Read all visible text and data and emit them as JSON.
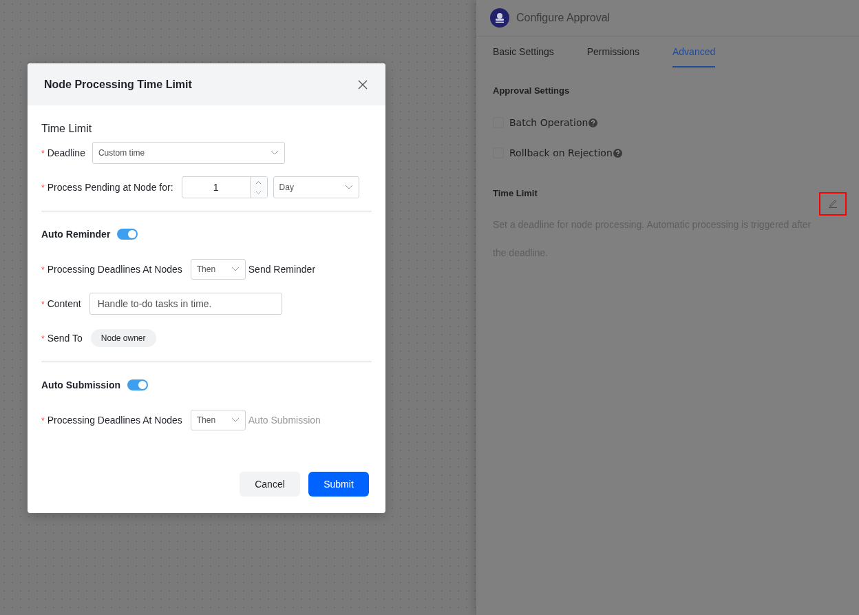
{
  "panel": {
    "title": "Configure Approval",
    "tabs": [
      {
        "label": "Basic Settings",
        "selected": false
      },
      {
        "label": "Permissions",
        "selected": false
      },
      {
        "label": "Advanced",
        "selected": true
      }
    ],
    "section_title": "Approval Settings",
    "options": [
      {
        "label": "Batch Operation",
        "checked": false
      },
      {
        "label": "Rollback on Rejection",
        "checked": false
      }
    ],
    "time_limit": {
      "title": "Time Limit",
      "description": "Set a deadline for node processing. Automatic processing is triggered after the deadline."
    }
  },
  "dialog": {
    "title": "Node Processing Time Limit",
    "section_title": "Time Limit",
    "time_fields": [
      {
        "kind": "dropdown",
        "label": "Deadline",
        "required_mark": "*",
        "value": "Custom time"
      },
      {
        "kind": "number",
        "label": "Process Pending at Node for:",
        "required_mark": "*",
        "value": "1",
        "unit": "Day"
      }
    ],
    "groups": [
      {
        "title": "Auto Reminder",
        "on": true,
        "fields": [
          {
            "kind": "select",
            "label": "Processing Deadlines At Nodes",
            "required_mark": "*",
            "value": "Then",
            "suffix": "Send Reminder",
            "suffix_disabled": false
          },
          {
            "kind": "text",
            "label": "Content",
            "required_mark": "*",
            "value": "Handle to-do tasks in time."
          },
          {
            "kind": "chip",
            "label": "Send To",
            "required_mark": "*",
            "value": "Node owner"
          }
        ]
      },
      {
        "title": "Auto Submission",
        "on": true,
        "fields": [
          {
            "kind": "select",
            "label": "Processing Deadlines At Nodes",
            "required_mark": "*",
            "value": "Then",
            "suffix": "Auto Submission",
            "suffix_disabled": true
          }
        ]
      }
    ],
    "buttons": [
      {
        "label": "Cancel",
        "kind": "secondary"
      },
      {
        "label": "Submit",
        "kind": "primary"
      }
    ]
  }
}
